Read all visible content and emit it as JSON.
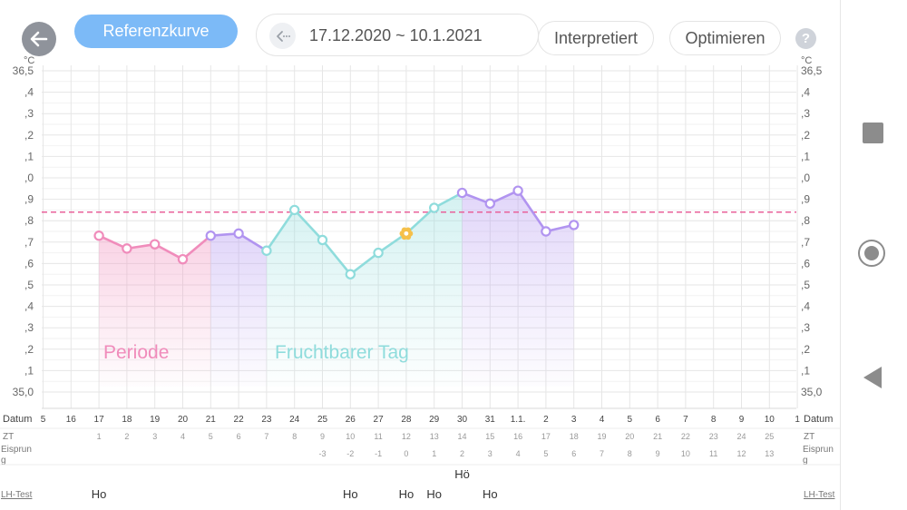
{
  "header": {
    "back_icon": "arrow-left-icon",
    "reference_curve_label": "Referenzkurve",
    "date_range": "17.12.2020 ~ 10.1.2021",
    "date_nav_icon": "chevron-left-dots-icon",
    "interpreted_label": "Interpretiert",
    "optimize_label": "Optimieren",
    "help_label": "?",
    "help_icon": "question-icon"
  },
  "chart_data": {
    "type": "line",
    "unit": "°C",
    "y_tick_labels": [
      "36,5",
      ",4",
      ",3",
      ",2",
      ",1",
      ",0",
      ",9",
      ",8",
      ",7",
      ",6",
      ",5",
      ",4",
      ",3",
      ",2",
      ",1",
      "35,0"
    ],
    "ylim": [
      35.0,
      36.5
    ],
    "reference_line": 35.84,
    "x_dates": [
      "5",
      "16",
      "17",
      "18",
      "19",
      "20",
      "21",
      "22",
      "23",
      "24",
      "25",
      "26",
      "27",
      "28",
      "29",
      "30",
      "31",
      "1.1.",
      "2",
      "3",
      "4",
      "5",
      "6",
      "7",
      "8",
      "9",
      "10",
      "1"
    ],
    "series": [
      {
        "date": "17",
        "value": 35.73,
        "phase": "period"
      },
      {
        "date": "18",
        "value": 35.67,
        "phase": "period"
      },
      {
        "date": "19",
        "value": 35.69,
        "phase": "period"
      },
      {
        "date": "20",
        "value": 35.62,
        "phase": "period"
      },
      {
        "date": "21",
        "value": 35.73,
        "phase": "luteal"
      },
      {
        "date": "22",
        "value": 35.74,
        "phase": "luteal"
      },
      {
        "date": "23",
        "value": 35.66,
        "phase": "fertile"
      },
      {
        "date": "24",
        "value": 35.85,
        "phase": "fertile"
      },
      {
        "date": "25",
        "value": 35.71,
        "phase": "fertile"
      },
      {
        "date": "26",
        "value": 35.55,
        "phase": "fertile"
      },
      {
        "date": "27",
        "value": 35.65,
        "phase": "fertile"
      },
      {
        "date": "28",
        "value": 35.74,
        "phase": "ovulation"
      },
      {
        "date": "29",
        "value": 35.86,
        "phase": "fertile"
      },
      {
        "date": "30",
        "value": 35.93,
        "phase": "luteal"
      },
      {
        "date": "31",
        "value": 35.88,
        "phase": "luteal"
      },
      {
        "date": "1.1.",
        "value": 35.94,
        "phase": "luteal"
      },
      {
        "date": "2",
        "value": 35.75,
        "phase": "luteal"
      },
      {
        "date": "3",
        "value": 35.78,
        "phase": "luteal"
      }
    ],
    "phase_labels": {
      "period": "Periode",
      "fertile": "Fruchtbarer Tag"
    },
    "colors": {
      "period": "#f08cbb",
      "fertile": "#8fdcdc",
      "luteal": "#b194f0",
      "ovulation": "#f5c04a",
      "reference": "#e8609a",
      "grid": "#e6e6e6"
    },
    "rows": {
      "date_label": "Datum",
      "cycle_day_label": "ZT",
      "cycle_days": [
        "",
        "",
        "1",
        "2",
        "3",
        "4",
        "5",
        "6",
        "7",
        "8",
        "9",
        "10",
        "11",
        "12",
        "13",
        "14",
        "15",
        "16",
        "17",
        "18",
        "19",
        "20",
        "21",
        "22",
        "23",
        "24",
        "25",
        ""
      ],
      "ovulation_label": "Eisprun g",
      "ovulation_days": [
        "",
        "",
        "",
        "",
        "",
        "",
        "",
        "",
        "",
        "",
        "-3",
        "-2",
        "-1",
        "0",
        "1",
        "2",
        "3",
        "4",
        "5",
        "6",
        "7",
        "8",
        "9",
        "10",
        "11",
        "12",
        "13",
        ""
      ],
      "lh_label": "LH-Test",
      "lh_values": [
        {
          "date": "17",
          "text": "Ho"
        },
        {
          "date": "26",
          "text": "Ho"
        },
        {
          "date": "28",
          "text": "Ho"
        },
        {
          "date": "29",
          "text": "Ho"
        },
        {
          "date": "30",
          "text": "Hö"
        },
        {
          "date": "31",
          "text": "Ho"
        }
      ]
    }
  },
  "navbar": {
    "recent_icon": "square-icon",
    "home_icon": "home-circle-icon",
    "back_icon": "triangle-back-icon"
  }
}
